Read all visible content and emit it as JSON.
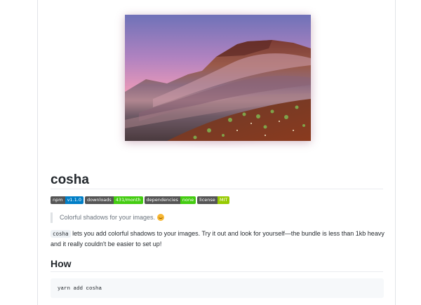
{
  "readme": {
    "title": "cosha",
    "badges": [
      {
        "label": "npm",
        "value": "v1.1.0",
        "color": "#007ec6"
      },
      {
        "label": "downloads",
        "value": "431/month",
        "color": "#4c1"
      },
      {
        "label": "dependencies",
        "value": "none",
        "color": "#4c1"
      },
      {
        "label": "license",
        "value": "MIT",
        "color": "#97ca00"
      }
    ],
    "quote": "Colorful shadows for your images.",
    "quote_emoji": "smiling-face-emoji",
    "intro": {
      "code": "cosha",
      "text": " lets you add colorful shadows to your images. Try it out and look for yourself—the bundle is less than 1kb heavy and it really couldn't be easier to set up!"
    },
    "how_heading": "How",
    "install_command": "yarn add cosha"
  },
  "colors": {
    "text": "#24292e",
    "muted": "#6a737d",
    "border": "#eaecef",
    "code_bg": "#f6f8fa"
  }
}
